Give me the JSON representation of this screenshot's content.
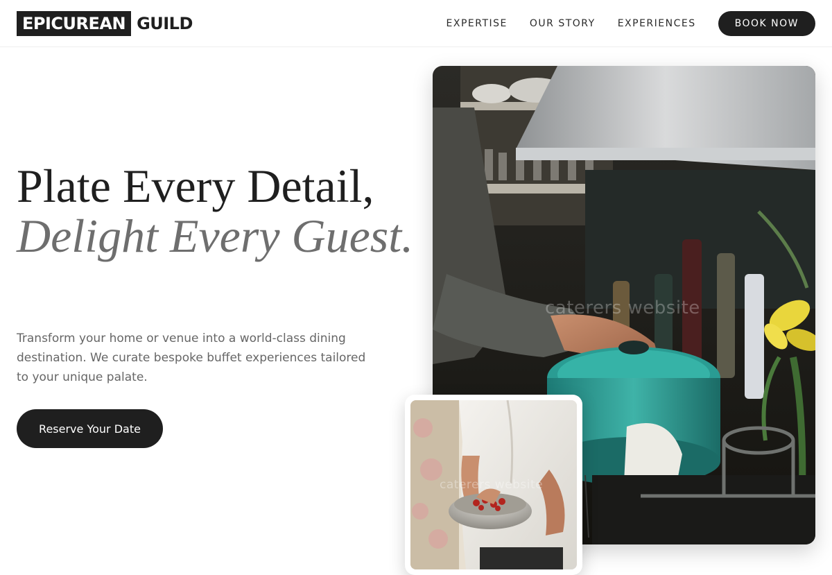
{
  "header": {
    "logo_box_text": "EPICUREAN",
    "logo_text": "GUILD",
    "nav": [
      {
        "label": "EXPERTISE"
      },
      {
        "label": "OUR STORY"
      },
      {
        "label": "EXPERIENCES"
      }
    ],
    "cta_label": "BOOK NOW"
  },
  "hero": {
    "title_line1": "Plate Every Detail,",
    "title_line2": "Delight Every Guest.",
    "description": "Transform your home or venue into a world-class dining destination. We curate bespoke buffet experiences tailored to your unique palate.",
    "cta_label": "Reserve Your Date"
  },
  "images": {
    "main_watermark": "caterers website",
    "small_watermark": "caterers website"
  },
  "colors": {
    "primary": "#1f1f1f",
    "muted_text": "#666666",
    "italic_text": "#6e6e6e",
    "background": "#ffffff"
  }
}
